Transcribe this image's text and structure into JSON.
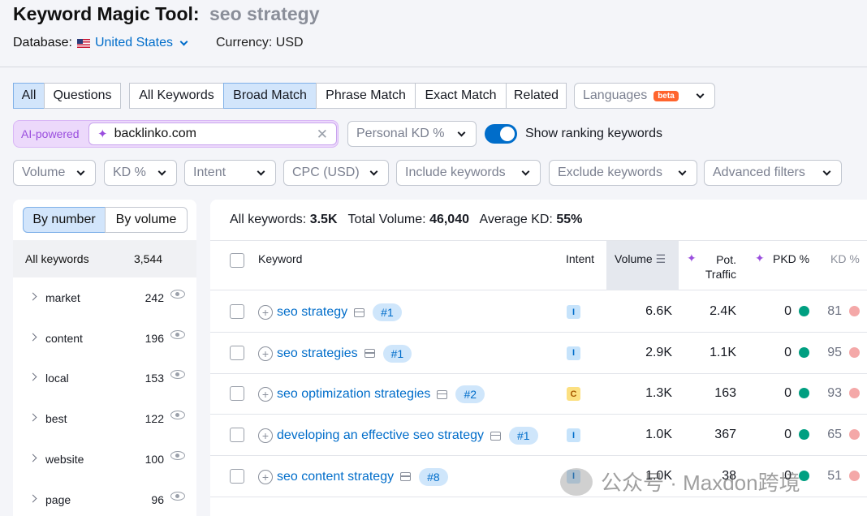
{
  "header": {
    "title": "Keyword Magic Tool:",
    "query": "seo strategy",
    "database_label": "Database:",
    "database": "United States",
    "currency": "Currency: USD"
  },
  "filters_row1": {
    "all": "All",
    "questions": "Questions",
    "all_keywords": "All Keywords",
    "broad_match": "Broad Match",
    "phrase_match": "Phrase Match",
    "exact_match": "Exact Match",
    "related": "Related",
    "languages": "Languages",
    "beta": "beta"
  },
  "filters_row2": {
    "ai_label": "AI-powered",
    "domain": "backlinko.com",
    "personal_kd": "Personal KD %",
    "show_ranking": "Show ranking keywords"
  },
  "filters_row3": [
    "Volume",
    "KD %",
    "Intent",
    "CPC (USD)",
    "Include keywords",
    "Exclude keywords",
    "Advanced filters"
  ],
  "sidebar": {
    "by_number": "By number",
    "by_volume": "By volume",
    "all_label": "All keywords",
    "all_count": "3,544",
    "groups": [
      {
        "name": "market",
        "count": "242"
      },
      {
        "name": "content",
        "count": "196"
      },
      {
        "name": "local",
        "count": "153"
      },
      {
        "name": "best",
        "count": "122"
      },
      {
        "name": "website",
        "count": "100"
      },
      {
        "name": "page",
        "count": "96"
      }
    ]
  },
  "summary": {
    "all_label": "All keywords:",
    "all_value": "3.5K",
    "vol_label": "Total Volume:",
    "vol_value": "46,040",
    "kd_label": "Average KD:",
    "kd_value": "55%"
  },
  "columns": {
    "keyword": "Keyword",
    "intent": "Intent",
    "volume": "Volume",
    "pot1": "Pot.",
    "pot2": "Traffic",
    "pkd": "PKD %",
    "kd": "KD %"
  },
  "rows": [
    {
      "keyword": "seo strategy",
      "rank": "#1",
      "intent": "I",
      "volume": "6.6K",
      "traffic": "2.4K",
      "pkd": "0",
      "kd": "81"
    },
    {
      "keyword": "seo strategies",
      "rank": "#1",
      "intent": "I",
      "volume": "2.9K",
      "traffic": "1.1K",
      "pkd": "0",
      "kd": "95"
    },
    {
      "keyword": "seo optimization strategies",
      "rank": "#2",
      "intent": "C",
      "volume": "1.3K",
      "traffic": "163",
      "pkd": "0",
      "kd": "93"
    },
    {
      "keyword": "developing an effective seo strategy",
      "rank": "#1",
      "intent": "I",
      "volume": "1.0K",
      "traffic": "367",
      "pkd": "0",
      "kd": "65"
    },
    {
      "keyword": "seo content strategy",
      "rank": "#8",
      "intent": "I",
      "volume": "1.0K",
      "traffic": "38",
      "pkd": "0",
      "kd": "51"
    }
  ],
  "watermark": "公众号 · Maxdon跨境",
  "colors": {
    "accent": "#006dca",
    "pkd_dot": "#009f81",
    "kd_dot": "#f4a8a8",
    "selected_bg": "#d2e5fb"
  }
}
